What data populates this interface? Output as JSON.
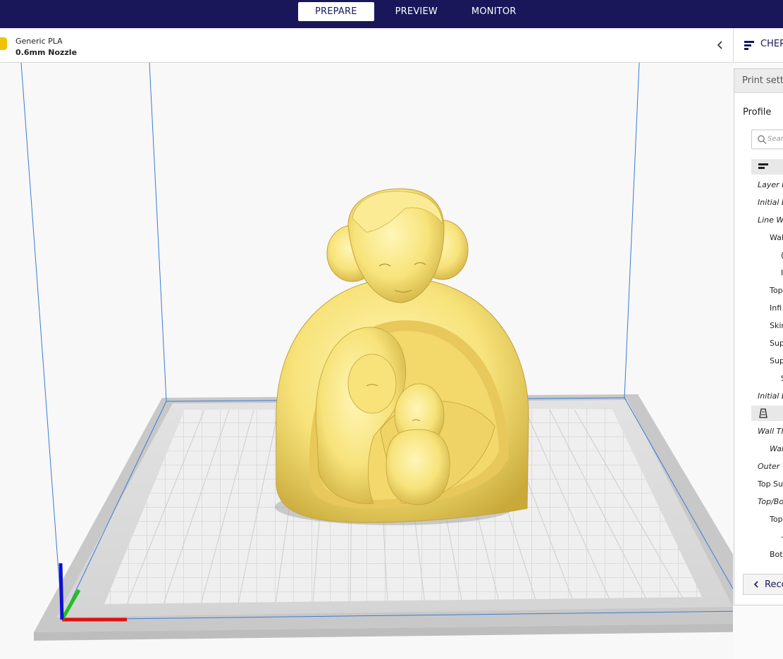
{
  "header": {
    "tabs": [
      {
        "label": "PREPARE",
        "active": true
      },
      {
        "label": "PREVIEW",
        "active": false
      },
      {
        "label": "MONITOR",
        "active": false
      }
    ],
    "background": "#19175a"
  },
  "printer_bar": {
    "material": "Generic PLA",
    "nozzle": "0.6mm Nozzle",
    "material_color": "#f2c200"
  },
  "profile_bar": {
    "name": "CHEP"
  },
  "settings_panel": {
    "title": "Print setti",
    "profile_label": "Profile",
    "search_placeholder": "Searc",
    "categories": [
      {
        "icon": "quality-icon",
        "label": "Q"
      },
      {
        "icon": "shell-icon",
        "label": "S"
      }
    ],
    "rows": [
      {
        "text": "Layer H",
        "italic": true
      },
      {
        "text": "Initial L",
        "italic": true
      },
      {
        "text": "Line Wic",
        "italic": true
      },
      {
        "text": "Wal",
        "italic": false
      },
      {
        "text": "(",
        "italic": false
      },
      {
        "text": "I",
        "italic": false
      },
      {
        "text": "Top",
        "italic": false
      },
      {
        "text": "Infi",
        "italic": false
      },
      {
        "text": "Skir",
        "italic": false
      },
      {
        "text": "Sup",
        "italic": false
      },
      {
        "text": "Sup",
        "italic": false
      },
      {
        "text": "S",
        "italic": false
      },
      {
        "text": "Initial L",
        "italic": true
      },
      {
        "text": "Wall Th",
        "italic": true
      },
      {
        "text": "Wal",
        "italic": true
      },
      {
        "text": "Outer W",
        "italic": true
      },
      {
        "text": "Top Su",
        "italic": false
      },
      {
        "text": "Top/Bot",
        "italic": true
      },
      {
        "text": "Top",
        "italic": false
      },
      {
        "text": "-",
        "italic": false
      },
      {
        "text": "Bot",
        "italic": false
      }
    ],
    "recommended_label": "Reco"
  },
  "colors": {
    "model": "#f7e37a",
    "build_volume_edge": "#3a7bd5",
    "axis_x": "#e01010",
    "axis_y": "#20c020",
    "axis_z": "#1010d0"
  }
}
